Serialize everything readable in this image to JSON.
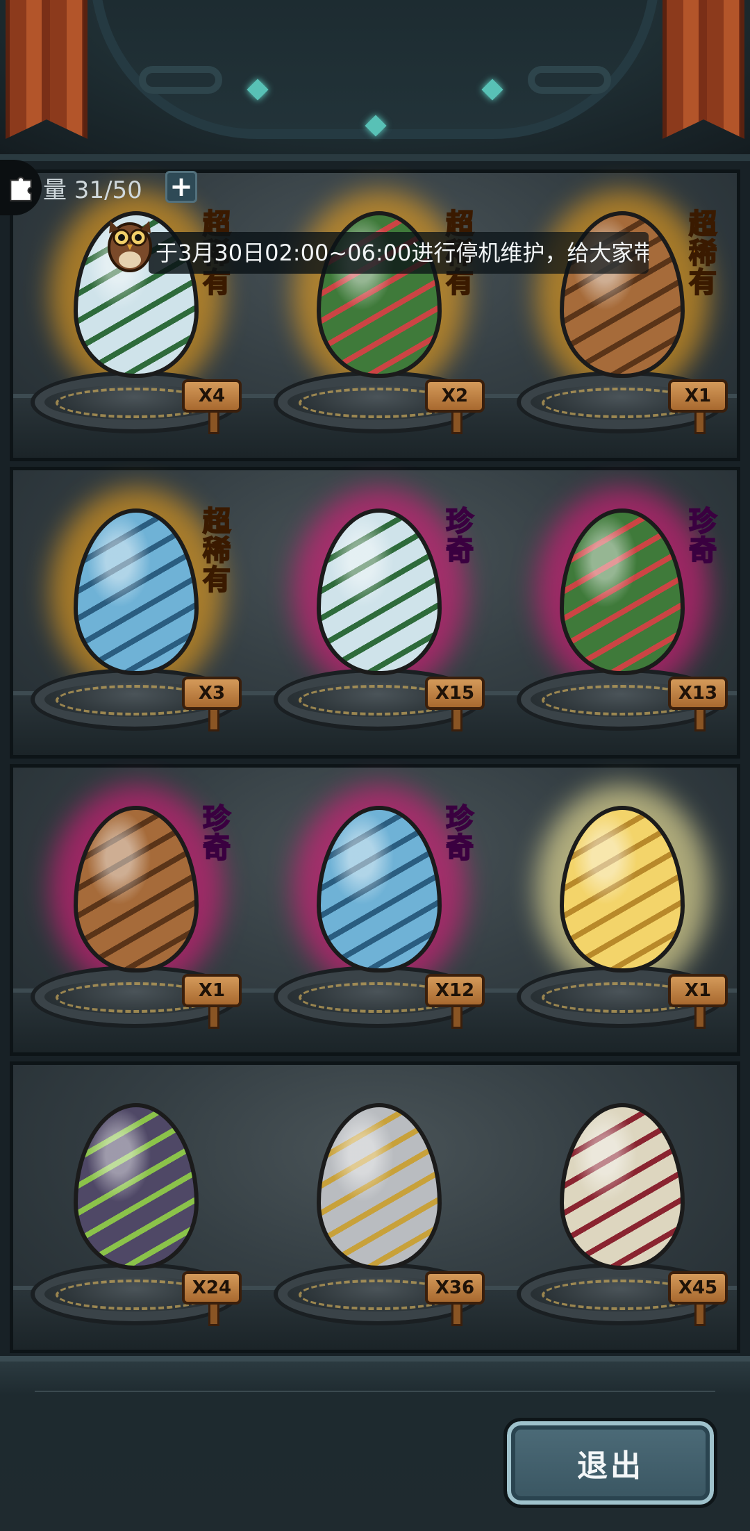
{
  "hud": {
    "capacity_label": "量 31/50",
    "plus_label": "+",
    "notice_text": "于3月30日02:00~06:00进行停机维护，给大家带"
  },
  "eggs": [
    {
      "rarity": "超稀有",
      "rarity_color": "#ffb21a",
      "count": "X4",
      "egg_color": "#cfe3ea",
      "accent": "#2e6b3b",
      "glow": "#f2a31a"
    },
    {
      "rarity": "超稀有",
      "rarity_color": "#ffb21a",
      "count": "X2",
      "egg_color": "#3f7a3a",
      "accent": "#c44",
      "glow": "#f2a31a"
    },
    {
      "rarity": "超稀有",
      "rarity_color": "#ffb21a",
      "count": "X1",
      "egg_color": "#a66b3a",
      "accent": "#5a3418",
      "glow": "#f2a31a"
    },
    {
      "rarity": "超稀有",
      "rarity_color": "#ffb21a",
      "count": "X3",
      "egg_color": "#6fb2d6",
      "accent": "#2a5d80",
      "glow": "#f2a31a"
    },
    {
      "rarity": "珍奇",
      "rarity_color": "#f04af0",
      "count": "X15",
      "egg_color": "#cfe3ea",
      "accent": "#2e6b3b",
      "glow": "#e01a7a"
    },
    {
      "rarity": "珍奇",
      "rarity_color": "#f04af0",
      "count": "X13",
      "egg_color": "#3f7a3a",
      "accent": "#c44",
      "glow": "#e01a7a"
    },
    {
      "rarity": "珍奇",
      "rarity_color": "#f04af0",
      "count": "X1",
      "egg_color": "#a66b3a",
      "accent": "#5a3418",
      "glow": "#e01a7a"
    },
    {
      "rarity": "珍奇",
      "rarity_color": "#f04af0",
      "count": "X12",
      "egg_color": "#6fb2d6",
      "accent": "#2a5d80",
      "glow": "#e01a7a"
    },
    {
      "rarity": "",
      "rarity_color": "#ffb21a",
      "count": "X1",
      "egg_color": "#f3d46a",
      "accent": "#b8892a",
      "glow": "#fff2a0"
    },
    {
      "rarity": "",
      "rarity_color": "#ffb21a",
      "count": "X24",
      "egg_color": "#4f4866",
      "accent": "#8bc34a",
      "glow": ""
    },
    {
      "rarity": "",
      "rarity_color": "#ffb21a",
      "count": "X36",
      "egg_color": "#b9bcc0",
      "accent": "#c8a13a",
      "glow": ""
    },
    {
      "rarity": "",
      "rarity_color": "#ffb21a",
      "count": "X45",
      "egg_color": "#ddd6bf",
      "accent": "#8a2430",
      "glow": ""
    }
  ],
  "footer": {
    "exit_label": "退出"
  }
}
